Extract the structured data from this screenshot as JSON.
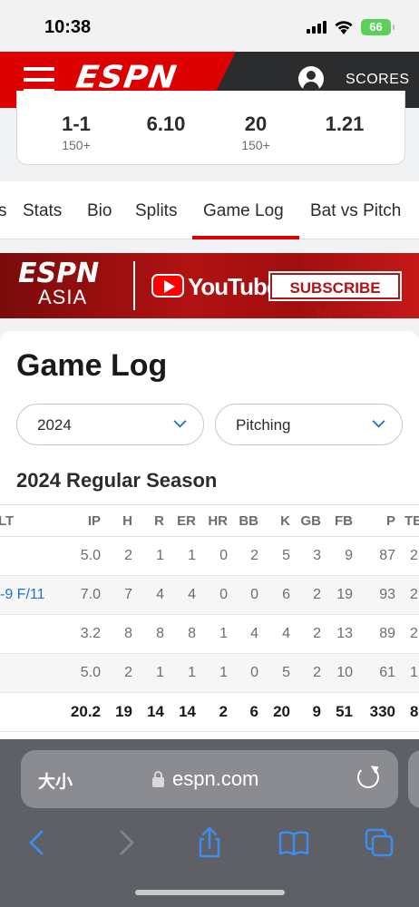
{
  "status_bar": {
    "time": "10:38",
    "battery": "66"
  },
  "header": {
    "logo": "ESPN",
    "scores_label": "SCORES"
  },
  "stat_summary": [
    {
      "value": "1-1",
      "sub": "150+"
    },
    {
      "value": "6.10",
      "sub": ""
    },
    {
      "value": "20",
      "sub": "150+"
    },
    {
      "value": "1.21",
      "sub": ""
    }
  ],
  "tabs": [
    "s",
    "Stats",
    "Bio",
    "Splits",
    "Game Log",
    "Bat vs Pitch"
  ],
  "active_tab": "Game Log",
  "banner": {
    "brand": "ESPN",
    "region": "ASIA",
    "platform": "YouTube",
    "cta": "SUBSCRIBE NOW"
  },
  "game_log": {
    "title": "Game Log",
    "year_select": "2024",
    "type_select": "Pitching",
    "season_title": "2024 Regular Season",
    "columns": [
      "LT",
      "IP",
      "H",
      "R",
      "ER",
      "HR",
      "BB",
      "K",
      "GB",
      "FB",
      "P",
      "TB"
    ],
    "rows": [
      [
        "",
        "5.0",
        "2",
        "1",
        "1",
        "0",
        "2",
        "5",
        "3",
        "9",
        "87",
        "2"
      ],
      [
        "-9 F/11",
        "7.0",
        "7",
        "4",
        "4",
        "0",
        "0",
        "6",
        "2",
        "19",
        "93",
        "2"
      ],
      [
        "",
        "3.2",
        "8",
        "8",
        "8",
        "1",
        "4",
        "4",
        "2",
        "13",
        "89",
        "2"
      ],
      [
        "",
        "5.0",
        "2",
        "1",
        "1",
        "1",
        "0",
        "5",
        "2",
        "10",
        "61",
        "1"
      ]
    ],
    "totals": [
      "",
      "20.2",
      "19",
      "14",
      "14",
      "2",
      "6",
      "20",
      "9",
      "51",
      "330",
      "8"
    ]
  },
  "safari": {
    "text_size_label": "大小",
    "url": "espn.com"
  },
  "colors": {
    "espn_red": "#dd0000",
    "link_blue": "#1f6fd1",
    "header_dark": "#2b2c2d"
  }
}
